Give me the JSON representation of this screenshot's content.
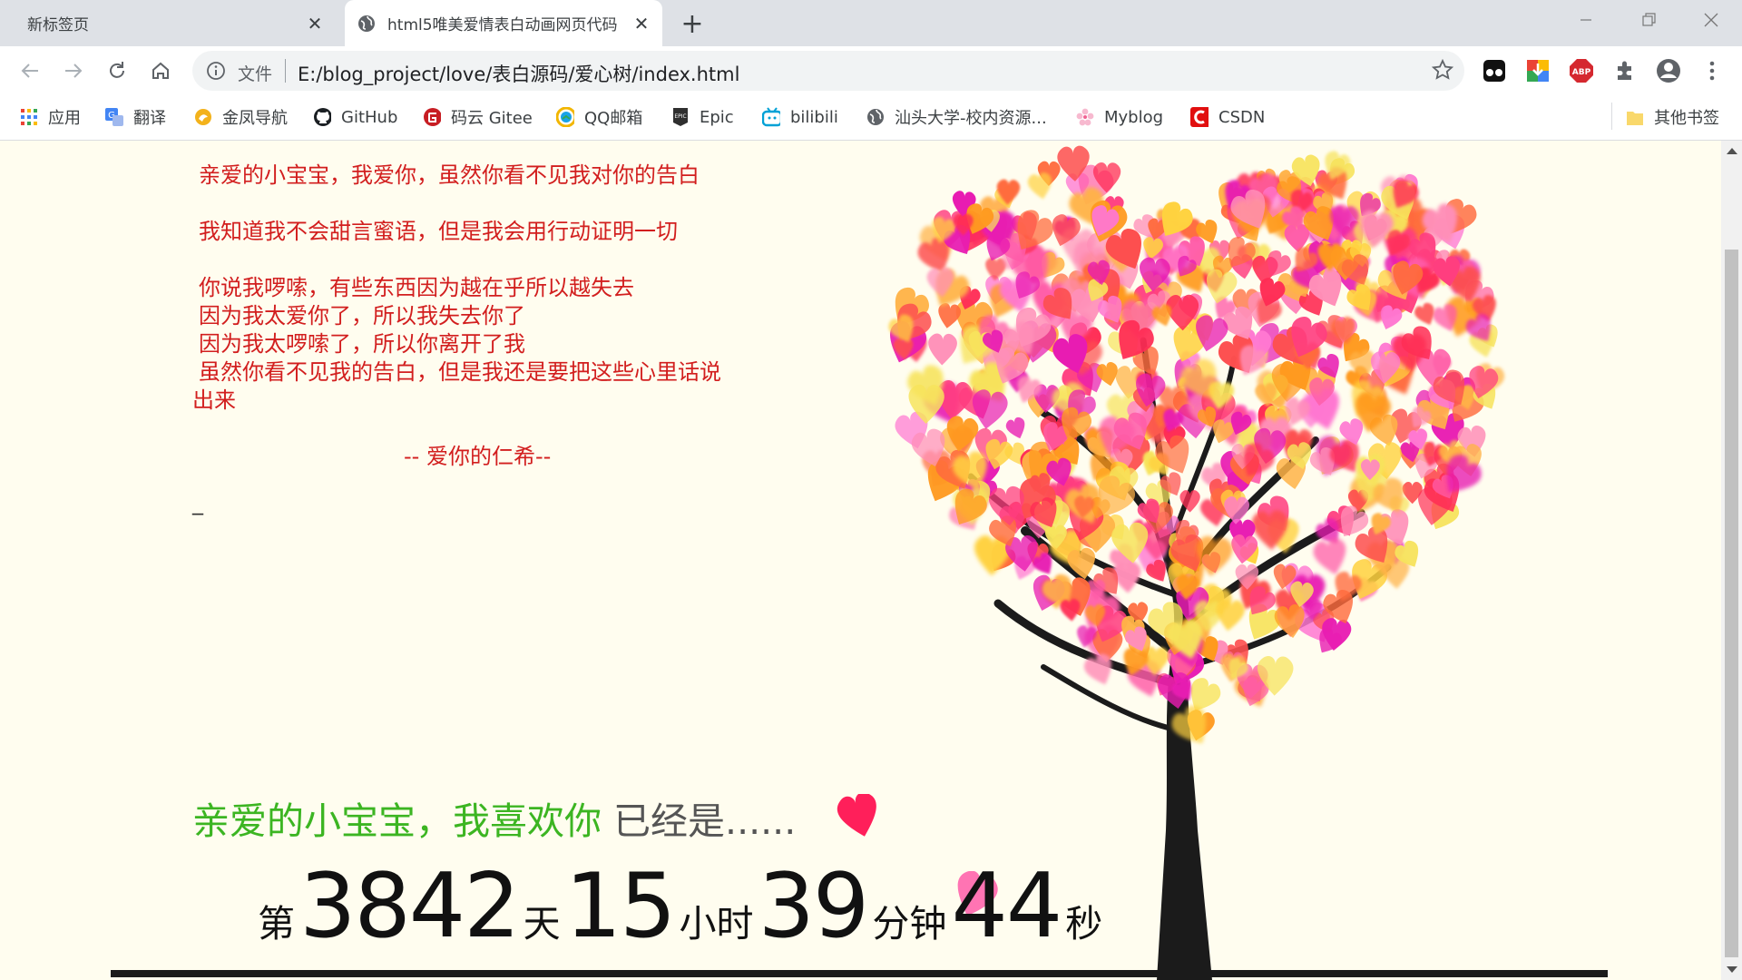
{
  "browser": {
    "tabs": [
      {
        "title": "新标签页",
        "active": false
      },
      {
        "title": "html5唯美爱情表白动画网页代码",
        "active": true
      }
    ],
    "new_tab_symbol": "+",
    "close_symbol": "✕",
    "window_controls": [
      "minimize-icon",
      "restore-icon",
      "close-icon"
    ]
  },
  "toolbar": {
    "nav_icons": [
      "back-arrow-icon",
      "forward-arrow-icon",
      "reload-icon",
      "home-icon"
    ],
    "omnibox": {
      "scheme_label": "文件",
      "url": "E:/blog_project/love/表白源码/爱心树/index.html"
    },
    "extensions": [
      "tampermonkey-icon",
      "download-helper-icon",
      "adblock-plus-icon",
      "puzzle-extensions-icon",
      "profile-avatar-icon",
      "menu-kebab-icon"
    ],
    "abp_text": "ABP"
  },
  "bookmarks": {
    "items": [
      {
        "label": "应用",
        "icon": "apps-grid-icon"
      },
      {
        "label": "翻译",
        "icon": "translate-icon"
      },
      {
        "label": "金凤导航",
        "icon": "phoenix-icon"
      },
      {
        "label": "GitHub",
        "icon": "github-icon"
      },
      {
        "label": "码云 Gitee",
        "icon": "gitee-icon"
      },
      {
        "label": "QQ邮箱",
        "icon": "qq-mail-icon"
      },
      {
        "label": "Epic",
        "icon": "epic-games-icon"
      },
      {
        "label": "bilibili",
        "icon": "bilibili-icon"
      },
      {
        "label": "汕头大学-校内资源...",
        "icon": "globe-icon"
      },
      {
        "label": "Myblog",
        "icon": "sakura-icon"
      },
      {
        "label": "CSDN",
        "icon": "csdn-icon"
      }
    ],
    "other": {
      "label": "其他书签",
      "icon": "folder-icon"
    }
  },
  "letter": {
    "lines": [
      "亲爱的小宝宝，我爱你，虽然你看不见我对你的告白",
      "",
      "我知道我不会甜言蜜语，但是我会用行动证明一切",
      "",
      "你说我啰嗦，有些东西因为越在乎所以越失去",
      "因为我太爱你了，所以我失去你了",
      "因为我太啰嗦了，所以你离开了我",
      "虽然你看不见我的告白，但是我还是要把这些心里话说",
      "出来",
      ""
    ],
    "signature": "-- 爱你的仁希--",
    "cursor": "_"
  },
  "greeting": {
    "part1": "亲爱的小宝宝，我喜欢你",
    "part2": " 已经是......"
  },
  "counter": {
    "prefix": "第",
    "days": "3842",
    "days_unit": "天",
    "hours": "15",
    "hours_unit": "小时",
    "minutes": "39",
    "minutes_unit": "分钟",
    "seconds": "44",
    "seconds_unit": "秒"
  },
  "colors": {
    "page_bg": "#fffdef",
    "letter_text": "#d21e1e",
    "greeting_green": "#3cb522",
    "trunk": "#1b1b1b",
    "heart_palette": [
      "#ff3e7f",
      "#ff2d55",
      "#ff6b3d",
      "#ff9a1f",
      "#ffd23f",
      "#ff5ca8",
      "#e81cb2",
      "#ff8fb8",
      "#fd4f4f",
      "#ffb347",
      "#f7e35c",
      "#ff77d1"
    ]
  }
}
